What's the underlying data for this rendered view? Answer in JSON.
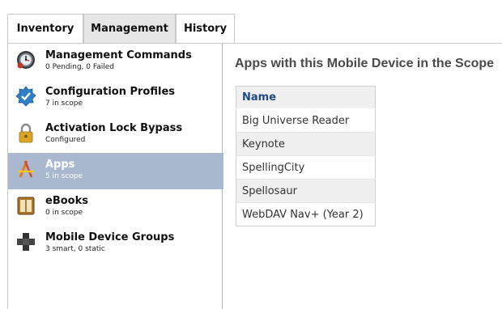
{
  "tabs": [
    {
      "label": "Inventory",
      "active": false
    },
    {
      "label": "Management",
      "active": true
    },
    {
      "label": "History",
      "active": false
    }
  ],
  "sidebar": {
    "items": [
      {
        "title": "Management Commands",
        "subtitle": "0 Pending, 0 Failed",
        "icon": "clock-gear-icon",
        "selected": false
      },
      {
        "title": "Configuration Profiles",
        "subtitle": "7 in scope",
        "icon": "badge-check-icon",
        "selected": false
      },
      {
        "title": "Activation Lock Bypass",
        "subtitle": "Configured",
        "icon": "padlock-icon",
        "selected": false
      },
      {
        "title": "Apps",
        "subtitle": "5 in scope",
        "icon": "app-store-icon",
        "selected": true
      },
      {
        "title": "eBooks",
        "subtitle": "0 in scope",
        "icon": "book-icon",
        "selected": false
      },
      {
        "title": "Mobile Device Groups",
        "subtitle": "3 smart, 0 static",
        "icon": "group-puzzle-icon",
        "selected": false
      }
    ]
  },
  "main": {
    "title": "Apps with this Mobile Device in the Scope",
    "table": {
      "header": "Name",
      "rows": [
        "Big Universe Reader",
        "Keynote",
        "SpellingCity",
        "Spellosaur",
        "WebDAV Nav+ (Year 2)"
      ]
    }
  },
  "colors": {
    "selected_row": "#aab8cf",
    "header_text": "#1f4a85",
    "active_tab": "#e6e6e6"
  }
}
